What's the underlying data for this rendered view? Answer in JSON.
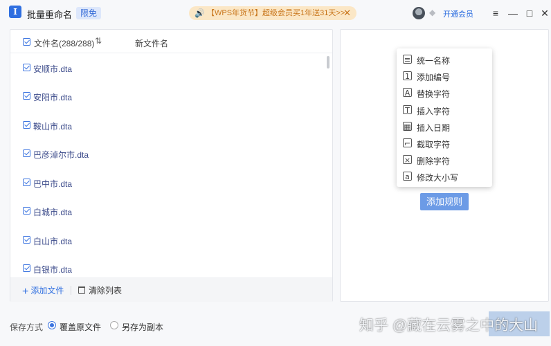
{
  "app": {
    "icon_glyph": "I",
    "title": "批量重命名",
    "badge": "限免"
  },
  "promo": {
    "speaker_icon": "speaker-icon",
    "text": "【WPS年货节】超级会员买1年送31天>>",
    "close": "✕"
  },
  "account": {
    "open_vip": "开通会员"
  },
  "window_controls": {
    "menu": "≡",
    "minimize": "—",
    "maximize": "□",
    "close": "✕"
  },
  "list": {
    "header_name": "文件名(288/288)",
    "header_sort_icon": "⇅",
    "header_newname": "新文件名",
    "files": [
      "安顺市.dta",
      "安阳市.dta",
      "鞍山市.dta",
      "巴彦淖尔市.dta",
      "巴中市.dta",
      "白城市.dta",
      "白山市.dta",
      "白银市.dta"
    ],
    "add_file": "添加文件",
    "clear_list": "清除列表"
  },
  "rule_menu": {
    "items": [
      {
        "label": "统一名称",
        "icon": "unify-name-icon",
        "glyph": "≡"
      },
      {
        "label": "添加编号",
        "icon": "numbering-icon",
        "glyph": "1"
      },
      {
        "label": "替换字符",
        "icon": "replace-icon",
        "glyph": "A"
      },
      {
        "label": "插入字符",
        "icon": "insert-text-icon",
        "glyph": "T"
      },
      {
        "label": "插入日期",
        "icon": "calendar-icon",
        "glyph": "▦"
      },
      {
        "label": "截取字符",
        "icon": "crop-icon",
        "glyph": "⌐"
      },
      {
        "label": "删除字符",
        "icon": "delete-char-icon",
        "glyph": "×"
      },
      {
        "label": "修改大小写",
        "icon": "case-icon",
        "glyph": "a"
      }
    ],
    "add_rule": "添加规则"
  },
  "save": {
    "label": "保存方式",
    "option_overwrite": "覆盖原文件",
    "option_copy": "另存为副本",
    "selected": "覆盖原文件"
  },
  "watermark": "知乎 @藏在云雾之中的大山",
  "colors": {
    "accent": "#2f6fe0",
    "button": "#6c9be6",
    "promo_bg": "#fbe7c6",
    "promo_text": "#c8751a"
  }
}
